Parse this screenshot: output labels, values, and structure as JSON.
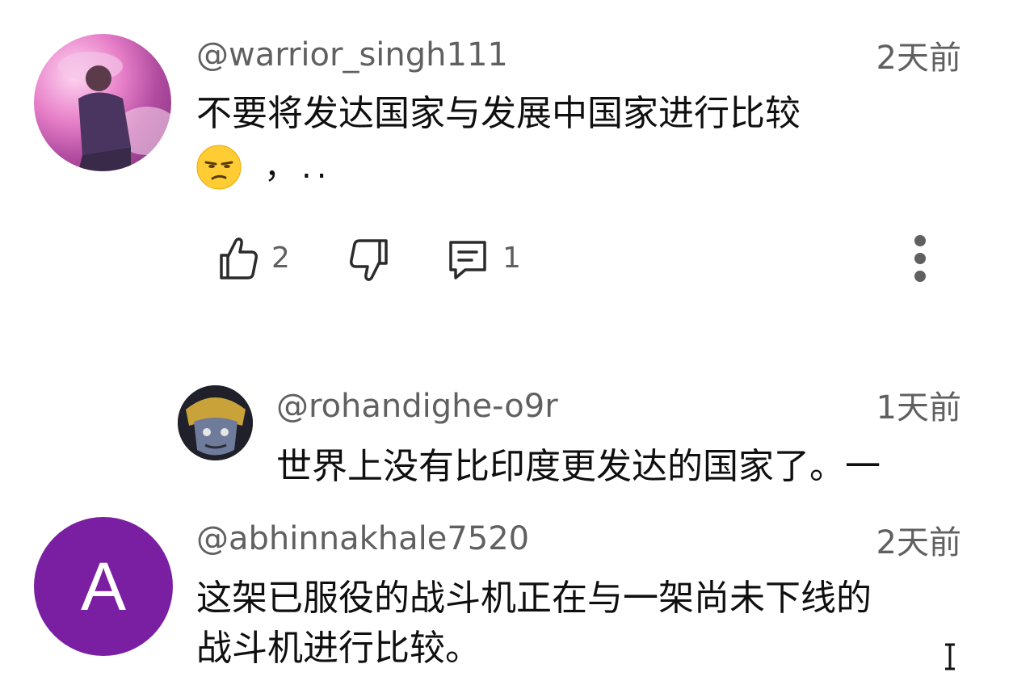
{
  "comments": [
    {
      "handle": "@warrior_singh111",
      "time": "2天前",
      "text": "不要将发达国家与发展中国家进行比较",
      "emoji": "unamused-face",
      "trailing": "，..",
      "likes": "2",
      "replies": "1"
    },
    {
      "handle": "@rohandighe-o9r",
      "time": "1天前",
      "text": "世界上没有比印度更发达的国家了。一"
    },
    {
      "handle": "@abhinnakhale7520",
      "time": "2天前",
      "avatar_letter": "A",
      "lines": [
        "这架已服役的战斗机正在与一架尚未下线的",
        "战斗机进行比较。"
      ]
    }
  ],
  "colors": {
    "avatar_letter_bg": "#7b1fa2",
    "meta_text": "#606060",
    "body_text": "#0f0f0f"
  },
  "icons": [
    "like-icon",
    "dislike-icon",
    "reply-icon",
    "more-vert-icon"
  ]
}
